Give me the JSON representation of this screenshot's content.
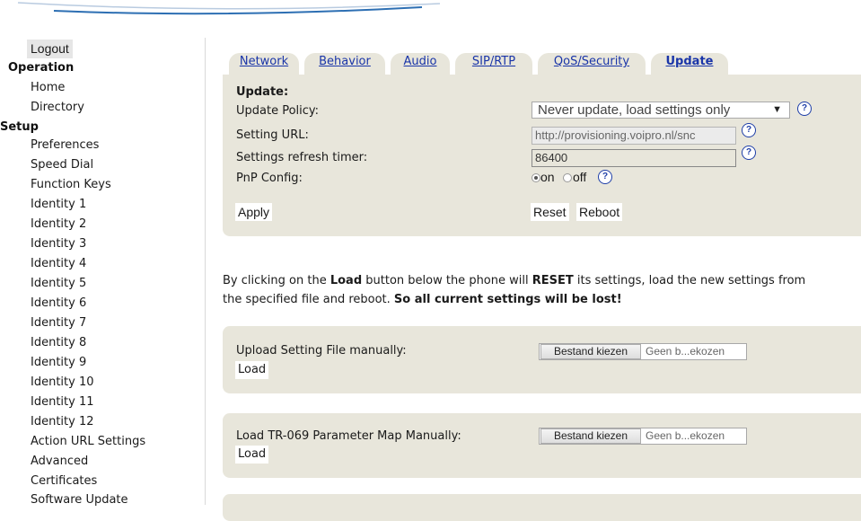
{
  "sidebar": {
    "logout": "Logout",
    "operation_heading": "Operation",
    "operation_items": [
      "Home",
      "Directory"
    ],
    "setup_heading": "Setup",
    "setup_items": [
      "Preferences",
      "Speed Dial",
      "Function Keys",
      "Identity 1",
      "Identity 2",
      "Identity 3",
      "Identity 4",
      "Identity 5",
      "Identity 6",
      "Identity 7",
      "Identity 8",
      "Identity 9",
      "Identity 10",
      "Identity 11",
      "Identity 12",
      "Action URL Settings",
      "Advanced",
      "Certificates",
      "Software Update"
    ]
  },
  "tabs": [
    "Network",
    "Behavior",
    "Audio",
    "SIP/RTP",
    "QoS/Security",
    "Update"
  ],
  "active_tab": "Update",
  "update": {
    "heading": "Update:",
    "policy_label": "Update Policy:",
    "policy_value": "Never update, load settings only",
    "url_label": "Setting URL:",
    "url_value": "http://provisioning.voipro.nl/snc",
    "timer_label": "Settings refresh timer:",
    "timer_value": "86400",
    "pnp_label": "PnP Config:",
    "pnp_on": "on",
    "pnp_off": "off",
    "pnp_selected": "on",
    "apply": "Apply",
    "reset": "Reset",
    "reboot": "Reboot",
    "help_glyph": "?"
  },
  "info": {
    "line1_pre": "By clicking on the ",
    "line1_load": "Load",
    "line1_mid": " button below the phone will ",
    "line1_reset": "RESET",
    "line1_post": " its settings, load the new settings from",
    "line2_pre": "the specified file and reboot. ",
    "line2_bold": "So all current settings will be lost!"
  },
  "upload": [
    {
      "label": "Upload Setting File manually:",
      "choose": "Bestand kiezen",
      "status": "Geen b...ekozen",
      "load": "Load"
    },
    {
      "label": "Load TR-069 Parameter Map Manually:",
      "choose": "Bestand kiezen",
      "status": "Geen b...ekozen",
      "load": "Load"
    }
  ],
  "colors": {
    "panel_bg": "#e8e6db",
    "link_blue": "#1a35a8",
    "help_blue": "#1f3fa8"
  }
}
